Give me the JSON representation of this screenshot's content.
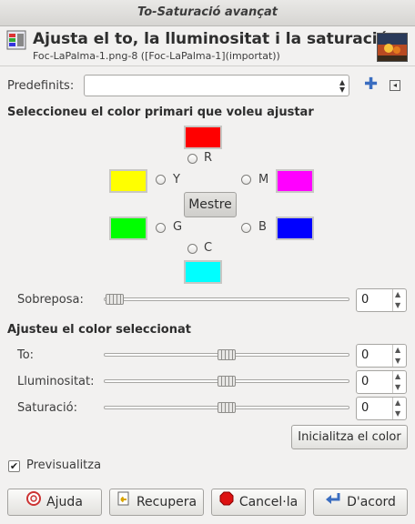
{
  "window": {
    "title": "To-Saturació avançat"
  },
  "header": {
    "title": "Ajusta el to, la lluminositat i la saturació",
    "subtitle": "Foc-LaPalma-1.png-8 ([Foc-LaPalma-1](importat))"
  },
  "presets": {
    "label": "Predefinits:",
    "value": ""
  },
  "primary": {
    "heading": "Seleccioneu el color primari que voleu ajustar",
    "colors": [
      {
        "key": "R",
        "label": "R",
        "hex": "#ff0000"
      },
      {
        "key": "Y",
        "label": "Y",
        "hex": "#ffff00"
      },
      {
        "key": "M",
        "label": "M",
        "hex": "#ff00ff"
      },
      {
        "key": "G",
        "label": "G",
        "hex": "#00ff00"
      },
      {
        "key": "B",
        "label": "B",
        "hex": "#0000ff"
      },
      {
        "key": "C",
        "label": "C",
        "hex": "#00ffff"
      }
    ],
    "master_label": "Mestre"
  },
  "overlap": {
    "label": "Sobreposa:",
    "value": "0",
    "level": 0
  },
  "adjust": {
    "heading": "Ajusteu el color seleccionat",
    "hue": {
      "label": "To:",
      "value": "0",
      "level": 0.5
    },
    "lightness": {
      "label": "Lluminositat:",
      "value": "0",
      "level": 0.5
    },
    "saturation": {
      "label": "Saturació:",
      "value": "0",
      "level": 0.5
    },
    "reset_label": "Inicialitza el color"
  },
  "preview": {
    "label": "Previsualitza",
    "checked": true
  },
  "buttons": {
    "help": "Ajuda",
    "reset": "Recupera",
    "cancel": "Cancel·la",
    "ok": "D'acord"
  }
}
